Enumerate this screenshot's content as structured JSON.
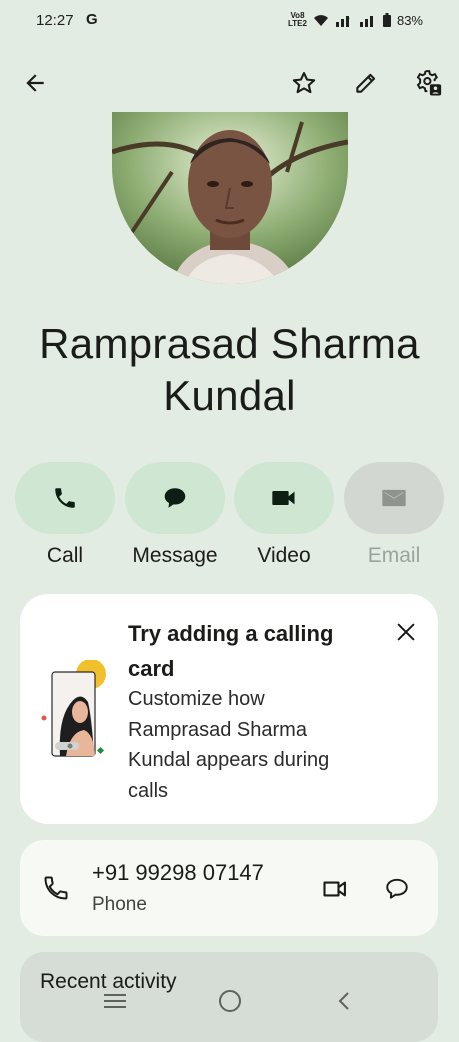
{
  "status": {
    "time": "12:27",
    "g_icon": "G",
    "volte": [
      "Vo8",
      "LTE2"
    ],
    "battery_pct": "83%"
  },
  "contact": {
    "name_line1": "Ramprasad Sharma",
    "name_line2": "Kundal"
  },
  "actions": [
    {
      "label": "Call",
      "icon": "phone-icon"
    },
    {
      "label": "Message",
      "icon": "chat-icon"
    },
    {
      "label": "Video",
      "icon": "videocam-icon"
    },
    {
      "label": "Email",
      "icon": "mail-icon"
    }
  ],
  "calling_card": {
    "title": "Try adding a calling card",
    "description": "Customize how Ramprasad Sharma Kundal appears during calls"
  },
  "phone": {
    "number": "+91 99298 07147",
    "type": "Phone"
  },
  "recent": {
    "title": "Recent activity"
  },
  "colors": {
    "background": "#e3ece3",
    "action_bg": "#cfe6d2",
    "card_bg": "#ffffff"
  }
}
